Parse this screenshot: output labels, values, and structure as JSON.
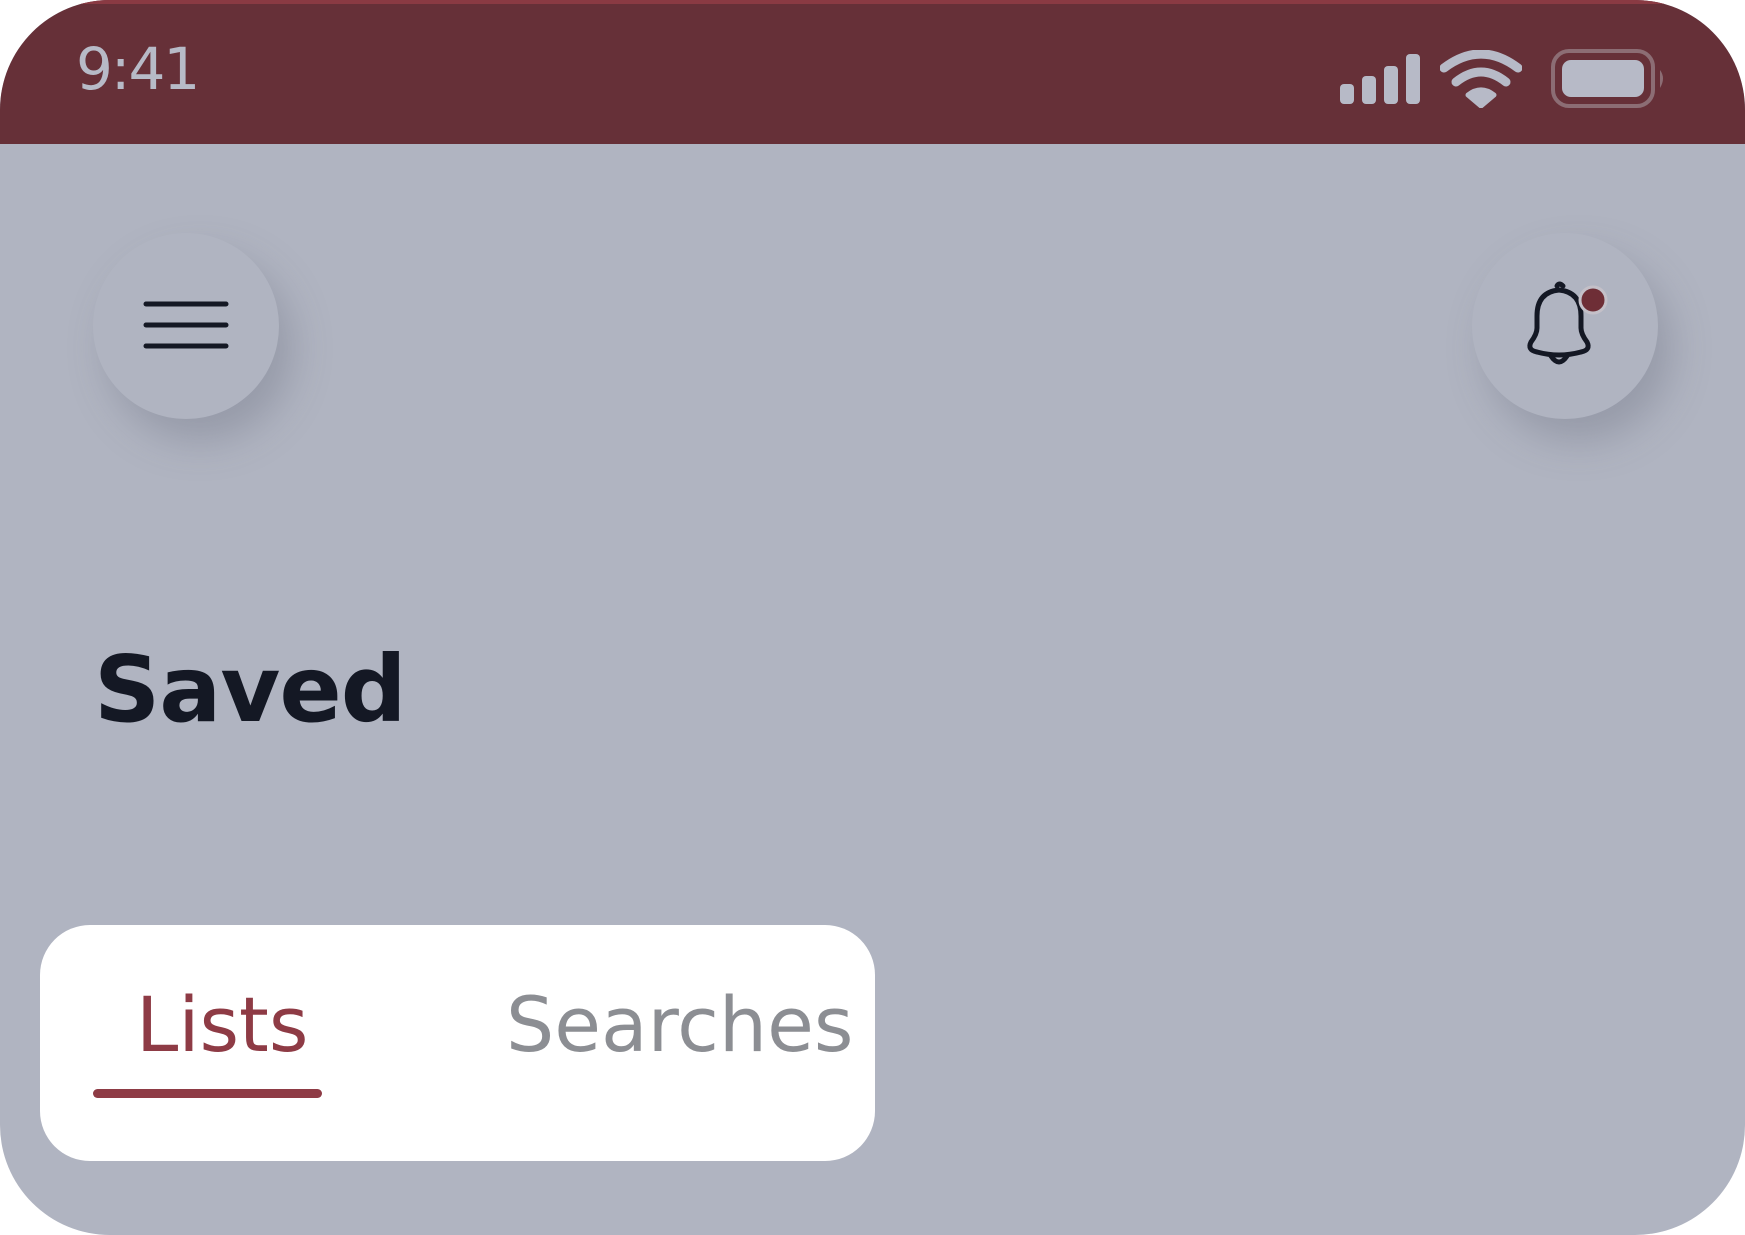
{
  "status_bar": {
    "time": "9:41",
    "background": "#663038",
    "icons": [
      "signal-icon",
      "wifi-icon",
      "battery-icon"
    ]
  },
  "header": {
    "menu_icon": "hamburger-menu-icon",
    "notification_icon": "bell-icon",
    "notification_badge_color": "#6e2e36"
  },
  "main": {
    "title": "Saved"
  },
  "tabs": {
    "items": [
      {
        "label": "Lists",
        "active": true
      },
      {
        "label": "Searches",
        "active": false
      }
    ],
    "active_color": "#8e3b45",
    "inactive_color": "#8c8e93"
  },
  "colors": {
    "background": "#b0b4c1",
    "text": "#141824",
    "card": "#ffffff"
  }
}
